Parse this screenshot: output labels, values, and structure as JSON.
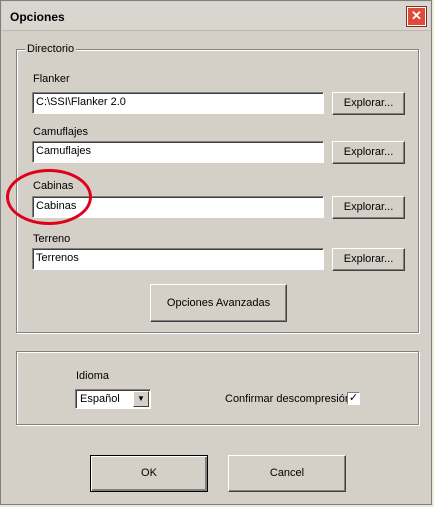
{
  "window": {
    "title": "Opciones",
    "close_glyph": "✕"
  },
  "directory": {
    "legend": "Directorio",
    "fields": [
      {
        "label": "Flanker",
        "value": "C:\\SSI\\Flanker 2.0",
        "button": "Explorar..."
      },
      {
        "label": "Camuflajes",
        "value": "Camuflajes",
        "button": "Explorar..."
      },
      {
        "label": "Cabinas",
        "value": "Cabinas",
        "button": "Explorar..."
      },
      {
        "label": "Terreno",
        "value": "Terrenos",
        "button": "Explorar..."
      }
    ],
    "advanced_button": "Opciones Avanzadas"
  },
  "settings": {
    "language_label": "Idioma",
    "language_value": "Español",
    "confirm_label": "Confirmar descompresión",
    "confirm_checked": true,
    "check_glyph": "✓"
  },
  "footer": {
    "ok": "OK",
    "cancel": "Cancel"
  },
  "colors": {
    "highlight": "#e0001a",
    "close": "#e04a3a"
  },
  "icons": [
    "close-icon",
    "dropdown-arrow-icon",
    "checkmark-icon"
  ]
}
